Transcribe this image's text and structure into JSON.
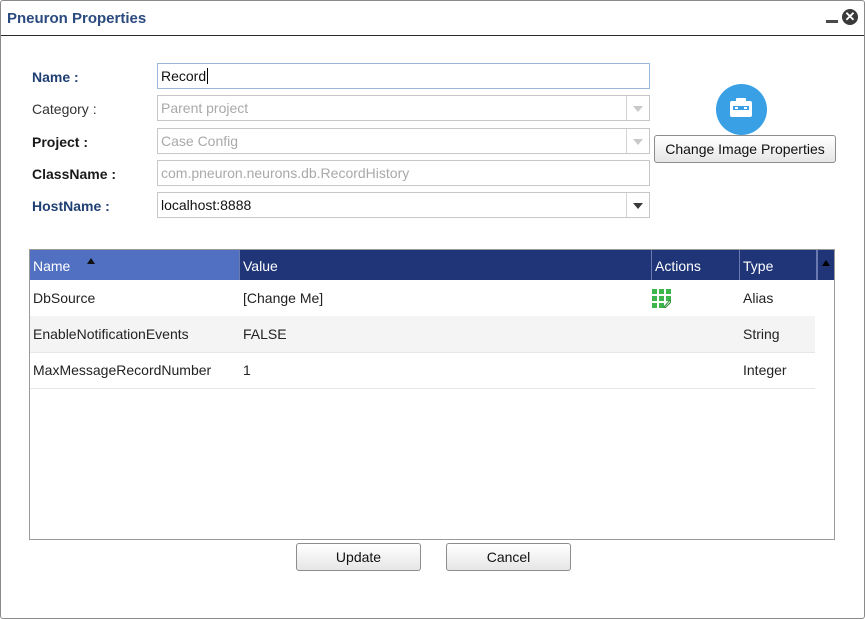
{
  "window": {
    "title": "Pneuron Properties"
  },
  "form": {
    "name_label": "Name :",
    "name_value": "Record",
    "category_label": "Category :",
    "category_value": "Parent project",
    "project_label": "Project :",
    "project_value": "Case Config",
    "classname_label": "ClassName :",
    "classname_value": "com.pneuron.neurons.db.RecordHistory",
    "hostname_label": "HostName :",
    "hostname_value": "localhost:8888"
  },
  "image_button_label": "Change Image Properties",
  "grid": {
    "columns": [
      "Name",
      "Value",
      "Actions",
      "Type"
    ],
    "rows": [
      {
        "name": "DbSource",
        "value": "[Change Me]",
        "type": "Alias"
      },
      {
        "name": "EnableNotificationEvents",
        "value": "FALSE",
        "type": "String"
      },
      {
        "name": "MaxMessageRecordNumber",
        "value": "1",
        "type": "Integer"
      }
    ]
  },
  "buttons": {
    "update": "Update",
    "cancel": "Cancel"
  },
  "colors": {
    "header": "#1f3577",
    "title": "#2b4a7f",
    "image_circle": "#3aa0e6",
    "action_icon": "#3db54a"
  }
}
